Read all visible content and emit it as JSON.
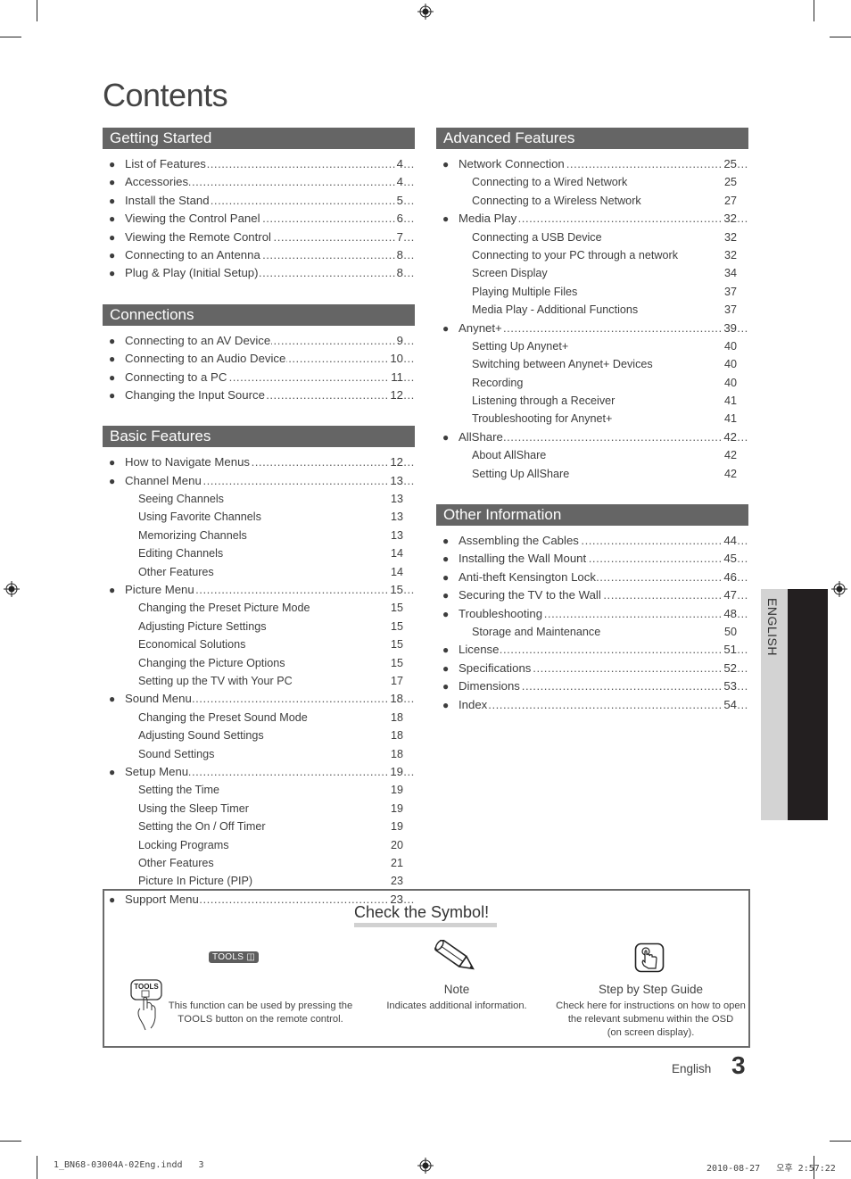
{
  "page": {
    "title": "Contents",
    "side_tab": "ENGLISH",
    "footer_language": "English",
    "page_number": "3",
    "slug_file": "1_BN68-03004A-02Eng.indd   3",
    "slug_date": "2010-08-27   오후 2:57:22"
  },
  "left_sections": [
    {
      "heading": "Getting Started",
      "items": [
        {
          "label": "List of Features",
          "page": "4",
          "type": "main"
        },
        {
          "label": "Accessories",
          "page": "4",
          "type": "main"
        },
        {
          "label": "Install the Stand",
          "page": "5",
          "type": "main"
        },
        {
          "label": "Viewing the Control Panel",
          "page": "6",
          "type": "main"
        },
        {
          "label": "Viewing the Remote Control",
          "page": "7",
          "type": "main"
        },
        {
          "label": "Connecting to an Antenna",
          "page": "8",
          "type": "main"
        },
        {
          "label": "Plug & Play (Initial Setup)",
          "page": "8",
          "type": "main"
        }
      ]
    },
    {
      "heading": "Connections",
      "items": [
        {
          "label": "Connecting to an AV Device",
          "page": "9",
          "type": "main"
        },
        {
          "label": "Connecting to an Audio Device",
          "page": "10",
          "type": "main"
        },
        {
          "label": "Connecting to a PC",
          "page": "11",
          "type": "main"
        },
        {
          "label": "Changing the Input Source",
          "page": "12",
          "type": "main"
        }
      ]
    },
    {
      "heading": "Basic Features",
      "items": [
        {
          "label": "How to Navigate Menus",
          "page": "12",
          "type": "main"
        },
        {
          "label": "Channel Menu",
          "page": "13",
          "type": "main"
        },
        {
          "label": "Seeing Channels",
          "page": "13",
          "type": "sub"
        },
        {
          "label": "Using Favorite Channels",
          "page": "13",
          "type": "sub"
        },
        {
          "label": "Memorizing Channels",
          "page": "13",
          "type": "sub"
        },
        {
          "label": "Editing Channels",
          "page": "14",
          "type": "sub"
        },
        {
          "label": "Other Features",
          "page": "14",
          "type": "sub"
        },
        {
          "label": "Picture Menu",
          "page": "15",
          "type": "main"
        },
        {
          "label": "Changing the Preset Picture Mode",
          "page": "15",
          "type": "sub"
        },
        {
          "label": "Adjusting Picture Settings",
          "page": "15",
          "type": "sub"
        },
        {
          "label": "Economical Solutions",
          "page": "15",
          "type": "sub"
        },
        {
          "label": "Changing the Picture Options",
          "page": "15",
          "type": "sub"
        },
        {
          "label": "Setting up the TV with Your PC",
          "page": "17",
          "type": "sub"
        },
        {
          "label": "Sound Menu",
          "page": "18",
          "type": "main"
        },
        {
          "label": "Changing the Preset Sound Mode",
          "page": "18",
          "type": "sub"
        },
        {
          "label": "Adjusting Sound Settings",
          "page": "18",
          "type": "sub"
        },
        {
          "label": "Sound Settings",
          "page": "18",
          "type": "sub"
        },
        {
          "label": "Setup Menu",
          "page": "19",
          "type": "main"
        },
        {
          "label": "Setting the Time",
          "page": "19",
          "type": "sub"
        },
        {
          "label": "Using the Sleep Timer",
          "page": "19",
          "type": "sub"
        },
        {
          "label": "Setting the On / Off Timer",
          "page": "19",
          "type": "sub"
        },
        {
          "label": "Locking Programs",
          "page": "20",
          "type": "sub"
        },
        {
          "label": "Other Features",
          "page": "21",
          "type": "sub"
        },
        {
          "label": "Picture In Picture (PIP)",
          "page": "23",
          "type": "sub"
        },
        {
          "label": "Support Menu",
          "page": "23",
          "type": "main"
        }
      ]
    }
  ],
  "right_sections": [
    {
      "heading": "Advanced Features",
      "items": [
        {
          "label": "Network Connection",
          "page": "25",
          "type": "main"
        },
        {
          "label": "Connecting to a Wired Network",
          "page": "25",
          "type": "sub"
        },
        {
          "label": "Connecting to a Wireless Network",
          "page": "27",
          "type": "sub"
        },
        {
          "label": "Media Play",
          "page": "32",
          "type": "main"
        },
        {
          "label": "Connecting a USB Device",
          "page": "32",
          "type": "sub"
        },
        {
          "label": "Connecting to your PC through a network",
          "page": "32",
          "type": "sub"
        },
        {
          "label": "Screen Display",
          "page": "34",
          "type": "sub"
        },
        {
          "label": "Playing Multiple Files",
          "page": "37",
          "type": "sub"
        },
        {
          "label": "Media Play - Additional Functions",
          "page": "37",
          "type": "sub"
        },
        {
          "label": "Anynet+",
          "page": "39",
          "type": "main"
        },
        {
          "label": "Setting Up Anynet+",
          "page": "40",
          "type": "sub"
        },
        {
          "label": "Switching between Anynet+ Devices",
          "page": "40",
          "type": "sub"
        },
        {
          "label": "Recording",
          "page": "40",
          "type": "sub"
        },
        {
          "label": "Listening through a Receiver",
          "page": "41",
          "type": "sub"
        },
        {
          "label": "Troubleshooting for Anynet+",
          "page": "41",
          "type": "sub"
        },
        {
          "label": "AllShare",
          "page": "42",
          "type": "main"
        },
        {
          "label": "About AllShare",
          "page": "42",
          "type": "sub"
        },
        {
          "label": "Setting Up AllShare",
          "page": "42",
          "type": "sub"
        }
      ]
    },
    {
      "heading": "Other Information",
      "items": [
        {
          "label": "Assembling the Cables",
          "page": "44",
          "type": "main"
        },
        {
          "label": "Installing the Wall Mount",
          "page": "45",
          "type": "main"
        },
        {
          "label": "Anti-theft Kensington Lock",
          "page": "46",
          "type": "main"
        },
        {
          "label": "Securing the TV to the Wall",
          "page": "47",
          "type": "main"
        },
        {
          "label": "Troubleshooting",
          "page": "48",
          "type": "main"
        },
        {
          "label": "Storage and Maintenance",
          "page": "50",
          "type": "sub"
        },
        {
          "label": "License",
          "page": "51",
          "type": "main"
        },
        {
          "label": "Specifications",
          "page": "52",
          "type": "main"
        },
        {
          "label": "Dimensions",
          "page": "53",
          "type": "main"
        },
        {
          "label": "Index",
          "page": "54",
          "type": "main"
        }
      ]
    }
  ],
  "symbols": {
    "title": "Check the Symbol!",
    "tools_badge": "TOOLS",
    "tools_remote_label": "TOOLS",
    "tools_desc_1": "This function can be used by pressing the",
    "tools_desc_2_bold": "TOOLS",
    "tools_desc_2_rest": " button on the remote control.",
    "note_heading": "Note",
    "note_desc": "Indicates additional information.",
    "guide_heading": "Step by Step Guide",
    "guide_desc_1": "Check here for instructions on how to open",
    "guide_desc_2": "the relevant submenu within the OSD",
    "guide_desc_3": "(on screen display)."
  }
}
